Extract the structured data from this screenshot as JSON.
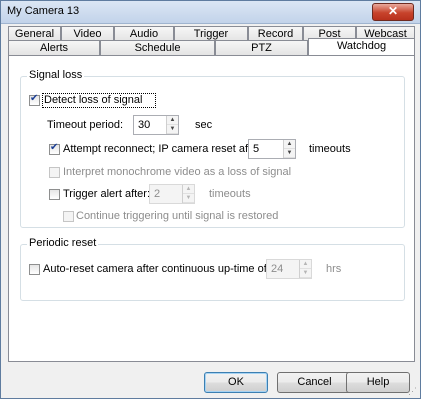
{
  "window": {
    "title": "My Camera 13",
    "close_glyph": "✕"
  },
  "tabs_row1": [
    "General",
    "Video",
    "Audio",
    "Trigger profiles",
    "Record",
    "Post",
    "Webcast"
  ],
  "tabs_row2": [
    "Alerts",
    "Schedule",
    "PTZ",
    "Watchdog"
  ],
  "active_tab": "Watchdog",
  "signal_loss": {
    "group_label": "Signal loss",
    "detect_label": "Detect loss of signal",
    "detect_checked": true,
    "timeout_label": "Timeout period:",
    "timeout_value": "30",
    "timeout_unit": "sec",
    "reconnect_label": "Attempt reconnect; IP camera reset after:",
    "reconnect_checked": true,
    "reconnect_value": "5",
    "reconnect_unit": "timeouts",
    "monochrome_label": "Interpret monochrome video as a loss of signal",
    "trigger_label": "Trigger alert after:",
    "trigger_value": "2",
    "trigger_unit": "timeouts",
    "continue_label": "Continue triggering until signal is restored"
  },
  "periodic_reset": {
    "group_label": "Periodic reset",
    "auto_reset_label": "Auto-reset camera after continuous up-time of",
    "auto_reset_value": "24",
    "auto_reset_unit": "hrs"
  },
  "buttons": {
    "ok": "OK",
    "cancel": "Cancel",
    "help": "Help"
  }
}
